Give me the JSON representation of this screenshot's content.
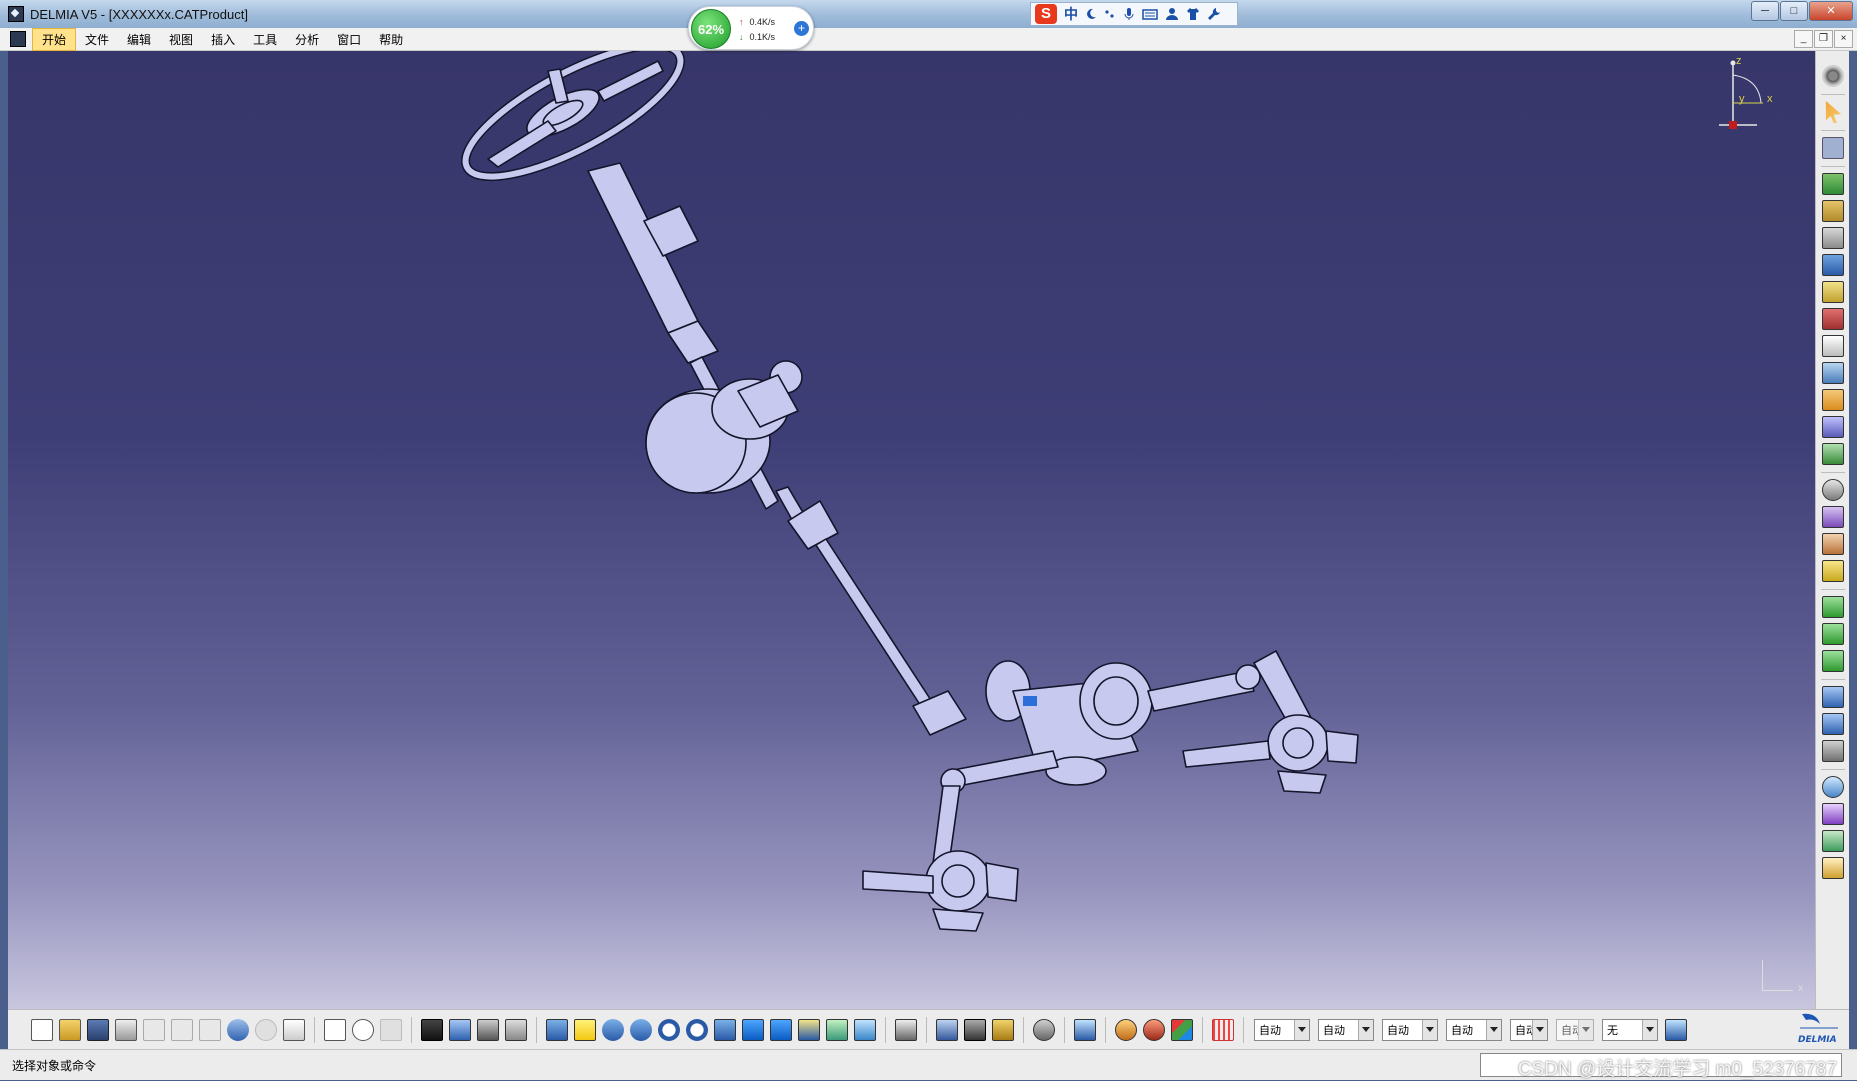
{
  "window": {
    "title": "DELMIA V5 - [XXXXXXx.CATProduct]",
    "minimize": "─",
    "maximize": "□",
    "close": "✕"
  },
  "net_monitor": {
    "percent": "62%",
    "upload": "0.4K/s",
    "download": "0.1K/s",
    "up_arrow": "↑",
    "down_arrow": "↓",
    "plus": "+"
  },
  "ime": {
    "logo": "S",
    "mode": "中",
    "icons": [
      "moon-icon",
      "punctuation-icon",
      "microphone-icon",
      "keyboard-icon",
      "user-icon",
      "shirt-icon",
      "wrench-icon"
    ]
  },
  "menu": {
    "items": [
      "开始",
      "文件",
      "编辑",
      "视图",
      "插入",
      "工具",
      "分析",
      "窗口",
      "帮助"
    ],
    "mdi_minimize": "_",
    "mdi_restore": "❐",
    "mdi_close": "×"
  },
  "compass": {
    "x": "x",
    "y": "y",
    "z": "z"
  },
  "corner_axis": {
    "x": "x"
  },
  "toolbar_bottom": {
    "combos": [
      "自动",
      "自动",
      "自动",
      "自动",
      "自动",
      "自动",
      "无"
    ]
  },
  "status": {
    "text": "选择对象或命令",
    "watermark": "CSDN @设计交流学习 m0_52376787"
  },
  "colors": {
    "viewport_top": "#37366a",
    "viewport_bottom": "#c9c6df",
    "part_fill": "#c7c9ef",
    "part_stroke": "#14142a"
  }
}
